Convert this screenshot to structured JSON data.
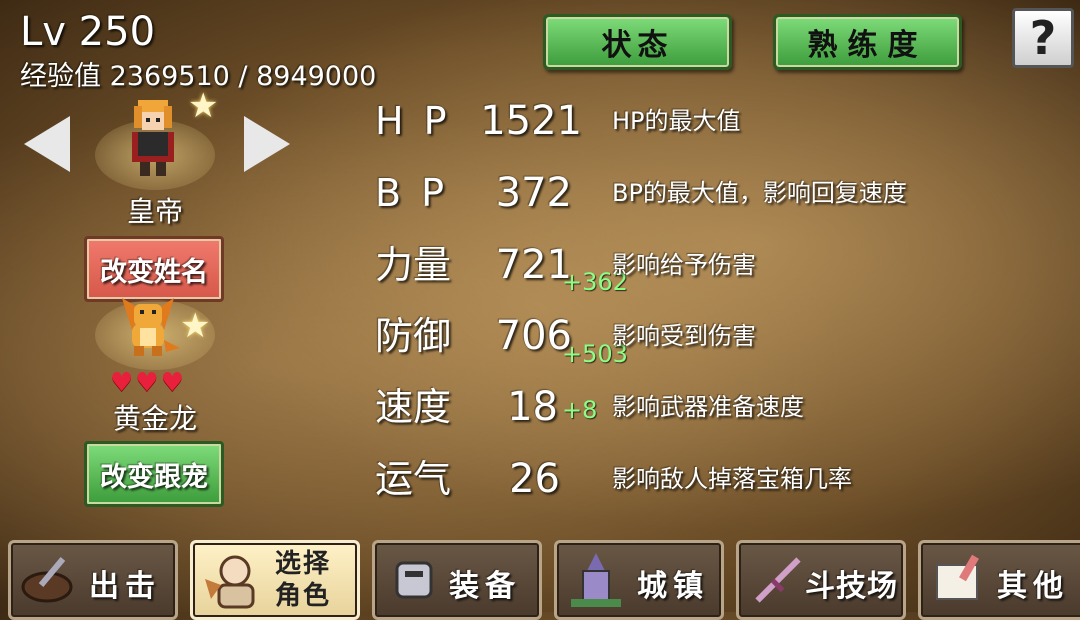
{
  "header": {
    "level": "Lv 250",
    "exp": "经验值 2369510 / 8949000"
  },
  "tabs": {
    "status": "状态",
    "proficiency": "熟练度",
    "help": "?"
  },
  "character": {
    "name": "皇帝",
    "rename_button": "改变姓名"
  },
  "pet": {
    "name": "黄金龙",
    "hearts": "♥♥♥",
    "change_button": "改变跟宠"
  },
  "stats": [
    {
      "label": "H P",
      "value": "1521",
      "bonus": "",
      "desc": "HP的最大值"
    },
    {
      "label": "B P",
      "value": "372",
      "bonus": "",
      "desc": "BP的最大值，影响回复速度"
    },
    {
      "label": "力量",
      "value": "721",
      "bonus": "+362",
      "desc": "影响给予伤害"
    },
    {
      "label": "防御",
      "value": "706",
      "bonus": "+503",
      "desc": "影响受到伤害"
    },
    {
      "label": "速度",
      "value": "18",
      "bonus": "+8",
      "desc": "影响武器准备速度"
    },
    {
      "label": "运气",
      "value": "26",
      "bonus": "",
      "desc": "影响敌人掉落宝箱几率"
    }
  ],
  "bottom_nav": {
    "sortie": "出击",
    "select_line1": "选择",
    "select_line2": "角色",
    "equip": "装备",
    "town": "城镇",
    "arena": "斗技场",
    "other": "其他"
  },
  "colors": {
    "bonus": "#8aff86",
    "heart": "#e8203c",
    "green_button": "#4fb84b",
    "red_button": "#e46a5c"
  }
}
